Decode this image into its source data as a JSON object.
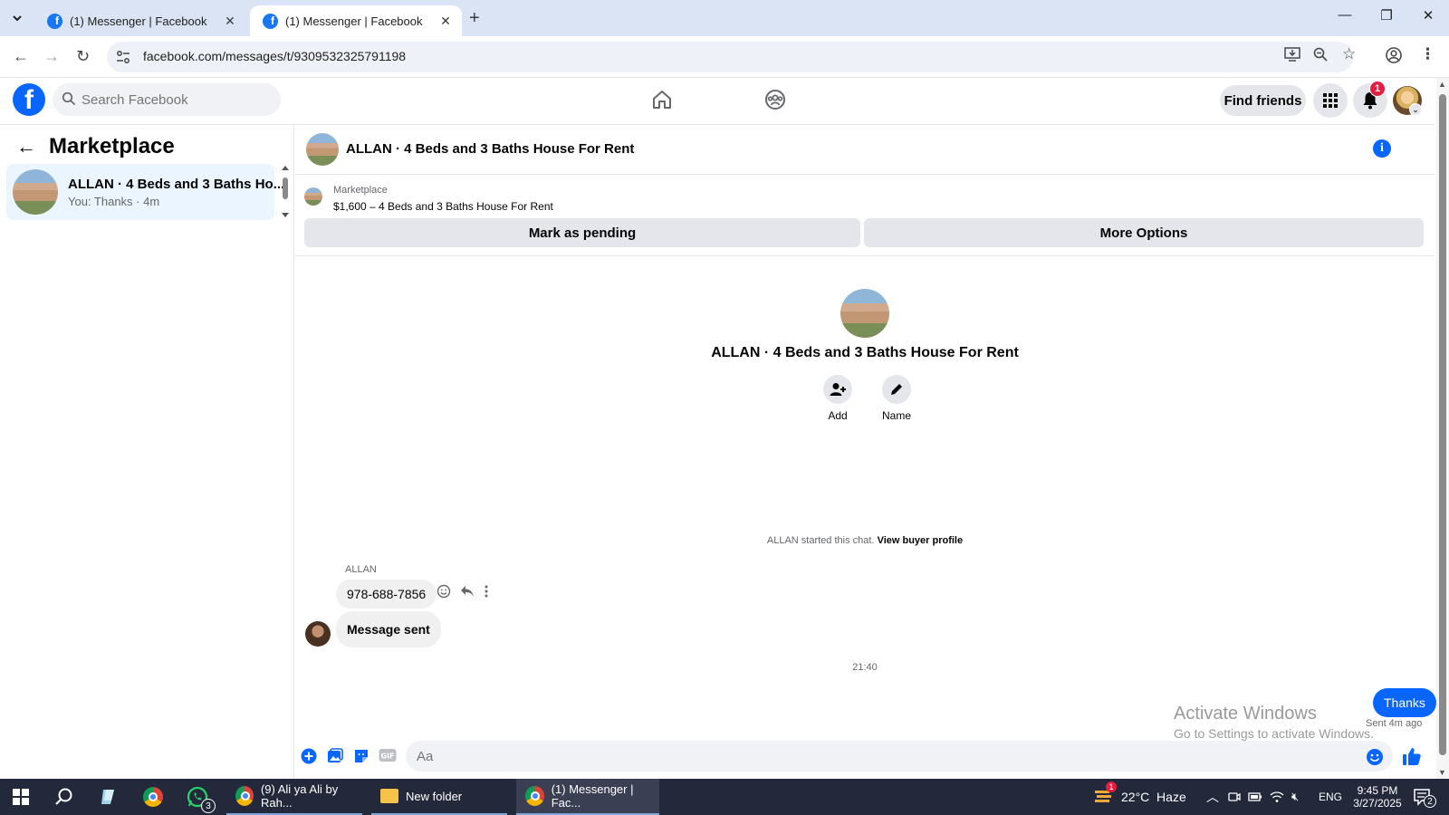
{
  "browser": {
    "tabs": [
      {
        "label": "(1) Messenger | Facebook",
        "active": false
      },
      {
        "label": "(1) Messenger | Facebook",
        "active": true
      }
    ],
    "url": "facebook.com/messages/t/9309532325791198"
  },
  "fb_header": {
    "search_placeholder": "Search Facebook",
    "find_friends": "Find friends",
    "notification_count": "1"
  },
  "sidebar": {
    "title": "Marketplace",
    "conversations": [
      {
        "name": "ALLAN · 4 Beds and 3 Baths Ho...",
        "preview": "You: Thanks · 4m"
      }
    ]
  },
  "chat": {
    "title": "ALLAN · 4 Beds and 3 Baths House For Rent",
    "marketplace_label": "Marketplace",
    "listing": "$1,600 – 4 Beds and 3 Baths House For Rent",
    "mark_pending": "Mark as pending",
    "more_options": "More Options",
    "intro_name": "ALLAN · 4 Beds and 3 Baths House For Rent",
    "add_label": "Add",
    "name_label": "Name",
    "started_text": "ALLAN started this chat.",
    "view_profile": "View buyer profile",
    "sender_name": "ALLAN",
    "msg_phone": "978-688-7856",
    "msg_sent": "Message sent",
    "timestamp": "21:40",
    "outgoing": "Thanks",
    "sent_status": "Sent 4m ago",
    "composer_placeholder": "Aa"
  },
  "watermark": {
    "line1": "Activate Windows",
    "line2": "Go to Settings to activate Windows."
  },
  "taskbar": {
    "whatsapp_count": "3",
    "apps": [
      {
        "label": "(9) Ali ya Ali by Rah..."
      },
      {
        "label": "New folder"
      },
      {
        "label": "(1) Messenger | Fac..."
      }
    ],
    "weather": "22°C  Haze",
    "weather_badge": "1",
    "lang": "ENG",
    "time": "9:45 PM",
    "date": "3/27/2025",
    "notif_count": "2"
  },
  "colors": {
    "fb_blue": "#0866ff",
    "tabbar": "#dbe4f4",
    "taskbar": "#23283a"
  }
}
